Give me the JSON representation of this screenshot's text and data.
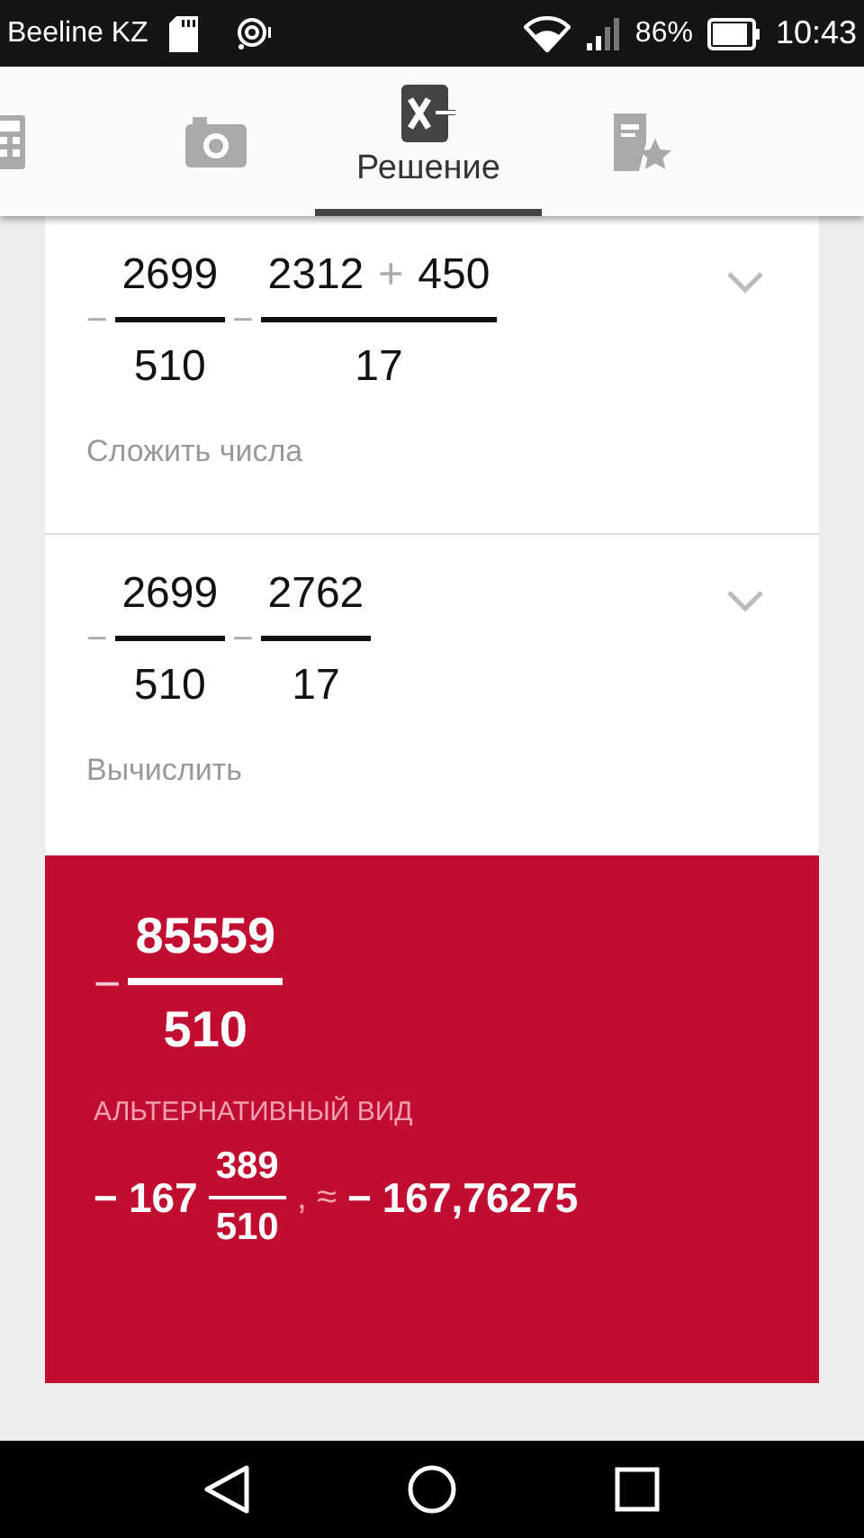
{
  "status_bar": {
    "carrier": "Beeline KZ",
    "battery": "86%",
    "time": "10:43"
  },
  "tabs": [
    {
      "kind": "calculator",
      "selected": false
    },
    {
      "kind": "camera",
      "selected": false
    },
    {
      "kind": "solution",
      "label": "Решение",
      "selected": true
    },
    {
      "kind": "notebook",
      "selected": false
    }
  ],
  "steps": [
    {
      "expression": [
        {
          "kind": "op",
          "text": "−"
        },
        {
          "kind": "frac",
          "num": [
            {
              "kind": "num",
              "text": "2699"
            }
          ],
          "den": "510"
        },
        {
          "kind": "op",
          "text": "−"
        },
        {
          "kind": "frac",
          "num": [
            {
              "kind": "num",
              "text": "2312"
            },
            {
              "kind": "op",
              "text": "+"
            },
            {
              "kind": "num",
              "text": "450"
            }
          ],
          "den": "17"
        }
      ],
      "caption": "Сложить числа",
      "expanded": false
    },
    {
      "expression": [
        {
          "kind": "op",
          "text": "−"
        },
        {
          "kind": "frac",
          "num": [
            {
              "kind": "num",
              "text": "2699"
            }
          ],
          "den": "510"
        },
        {
          "kind": "op",
          "text": "−"
        },
        {
          "kind": "frac",
          "num": [
            {
              "kind": "num",
              "text": "2762"
            }
          ],
          "den": "17"
        }
      ],
      "caption": "Вычислить",
      "expanded": false
    }
  ],
  "result": {
    "expression": [
      {
        "kind": "op",
        "text": "−"
      },
      {
        "kind": "frac",
        "num": [
          {
            "kind": "num",
            "text": "85559"
          }
        ],
        "den": "510"
      }
    ],
    "alternative_label": "АЛЬТЕРНАТИВНЫЙ ВИД",
    "alternative": [
      {
        "kind": "num",
        "text": "−"
      },
      {
        "kind": "num",
        "text": "167"
      },
      {
        "kind": "frac",
        "num": [
          {
            "kind": "num",
            "text": "389"
          }
        ],
        "den": "510"
      },
      {
        "kind": "op",
        "text": ", ≈"
      },
      {
        "kind": "num",
        "text": "−"
      },
      {
        "kind": "num",
        "text": "167,76275"
      }
    ]
  }
}
